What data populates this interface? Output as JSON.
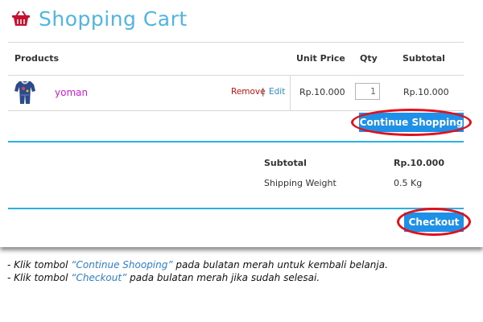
{
  "header": {
    "title": "Shopping Cart",
    "icon": "basket-icon",
    "title_color": "#4fb6e3"
  },
  "table": {
    "headers": {
      "products": "Products",
      "unit_price": "Unit Price",
      "qty": "Qty",
      "subtotal": "Subtotal"
    },
    "rows": [
      {
        "name": "yoman",
        "remove": "Remove",
        "separator": "|",
        "edit": "Edit",
        "unit_price": "Rp.10.000",
        "qty": "1",
        "subtotal": "Rp.10.000"
      }
    ]
  },
  "buttons": {
    "continue": "Continue Shopping",
    "checkout": "Checkout",
    "color": "#1e90e8",
    "highlight_ring_color": "#e0101c"
  },
  "summary": {
    "subtotal_label": "Subtotal",
    "subtotal_value": "Rp.10.000",
    "weight_label": "Shipping Weight",
    "weight_value": "0.5 Kg"
  },
  "instructions": [
    {
      "prefix": "- Klik tombol ",
      "highlight": "“Continue Shooping”",
      "suffix": " pada bulatan merah untuk kembali belanja."
    },
    {
      "prefix": "- Klik tombol ",
      "highlight": "“Checkout”",
      "suffix": " pada bulatan merah jika sudah selesai."
    }
  ]
}
